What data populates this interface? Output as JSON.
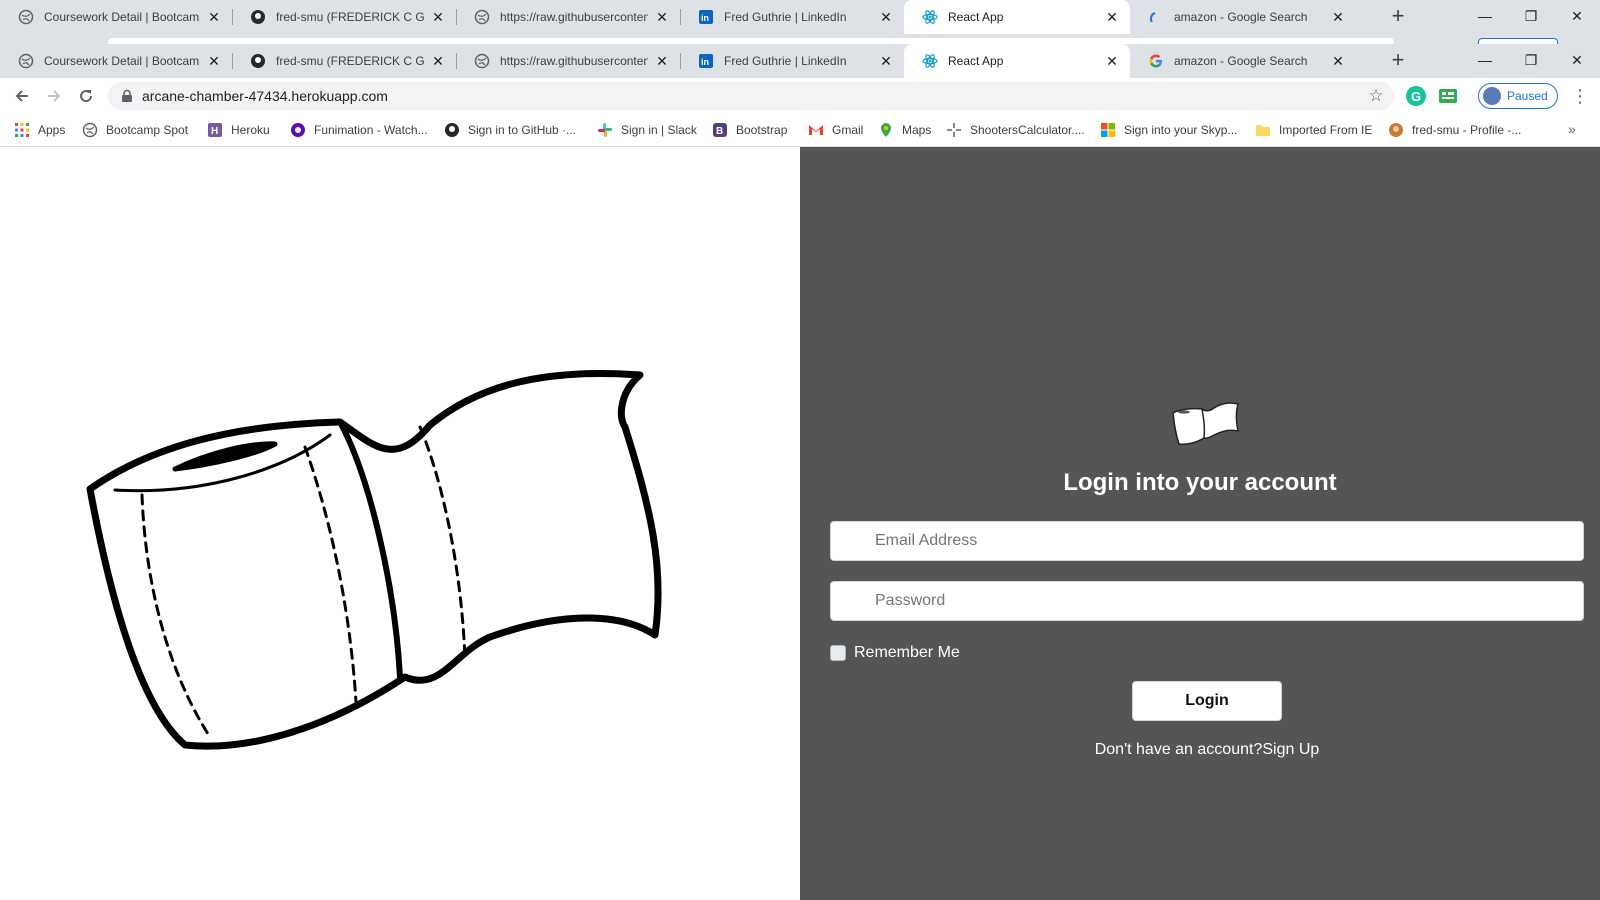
{
  "browser": {
    "tabs": [
      {
        "title": "Coursework Detail | Bootcamp",
        "icon": "globe-icon",
        "active": false
      },
      {
        "title": "fred-smu (FREDERICK C GUTHR",
        "icon": "github-icon",
        "active": false
      },
      {
        "title": "https://raw.githubusercontent.",
        "icon": "globe-icon",
        "active": false
      },
      {
        "title": "Fred Guthrie | LinkedIn",
        "icon": "linkedin-icon",
        "active": false
      },
      {
        "title": "React App",
        "icon": "react-icon",
        "active": true
      },
      {
        "title": "amazon - Google Search",
        "icon": "google-icon",
        "active": false
      }
    ],
    "new_tab": "+",
    "address": "arcane-chamber-47434.herokuapp.com",
    "profile_status": "Paused",
    "bookmarks": [
      {
        "label": "Apps",
        "icon": "apps-grid-icon"
      },
      {
        "label": "Bootcamp Spot",
        "icon": "globe-icon"
      },
      {
        "label": "Heroku",
        "icon": "heroku-icon"
      },
      {
        "label": "Funimation - Watch...",
        "icon": "funimation-icon"
      },
      {
        "label": "Sign in to GitHub ·...",
        "icon": "github-icon"
      },
      {
        "label": "Sign in | Slack",
        "icon": "slack-icon"
      },
      {
        "label": "Bootstrap",
        "icon": "bootstrap-icon"
      },
      {
        "label": "Gmail",
        "icon": "gmail-icon"
      },
      {
        "label": "Maps",
        "icon": "maps-icon"
      },
      {
        "label": "ShootersCalculator....",
        "icon": "crosshair-icon"
      },
      {
        "label": "Sign into your Skyp...",
        "icon": "microsoft-icon"
      },
      {
        "label": "Imported From IE",
        "icon": "folder-icon"
      },
      {
        "label": "fred-smu - Profile -...",
        "icon": "avatar-icon"
      }
    ],
    "bookmarks_overflow": "»"
  },
  "login": {
    "title": "Login into your account",
    "email_placeholder": "Email Address",
    "password_placeholder": "Password",
    "remember_label": "Remember Me",
    "button_label": "Login",
    "signup_prompt": "Don't have an account?",
    "signup_link": "Sign Up"
  },
  "colors": {
    "panel_bg": "#555555",
    "page_bg": "#ffffff",
    "tab_strip": "#dee1e6",
    "accent": "#1a73e8"
  }
}
